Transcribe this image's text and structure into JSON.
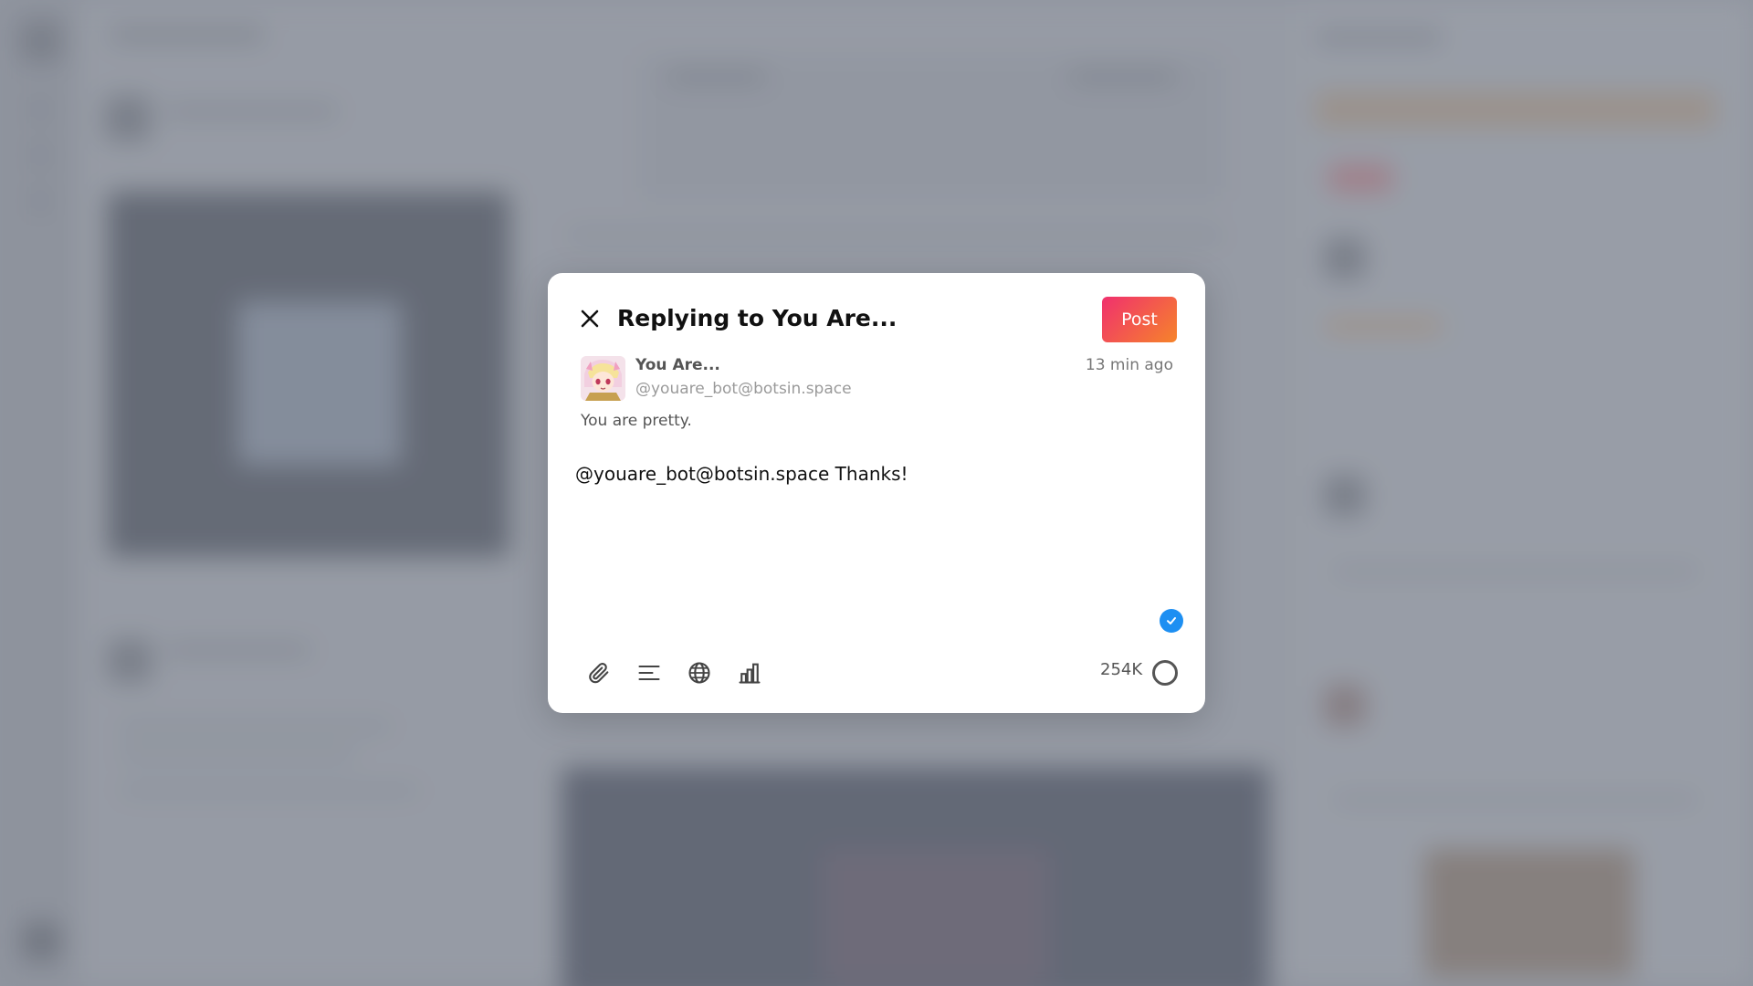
{
  "dialog": {
    "title": "Replying to You Are...",
    "post_label": "Post",
    "close_icon": "close-icon"
  },
  "original_post": {
    "display_name": "You Are...",
    "handle": "@youare_bot@botsin.space",
    "time_ago": "13 min ago",
    "text": "You are pretty."
  },
  "reply": {
    "value": "@youare_bot@botsin.space Thanks!"
  },
  "toolbar": {
    "icons": [
      "paperclip-icon",
      "align-left-icon",
      "globe-icon",
      "bar-chart-icon"
    ],
    "char_count": "254K"
  },
  "colors": {
    "post_gradient_start": "#f0306e",
    "post_gradient_end": "#f6842a",
    "check_blue": "#1d8ff2",
    "icon_gray": "#444444"
  }
}
